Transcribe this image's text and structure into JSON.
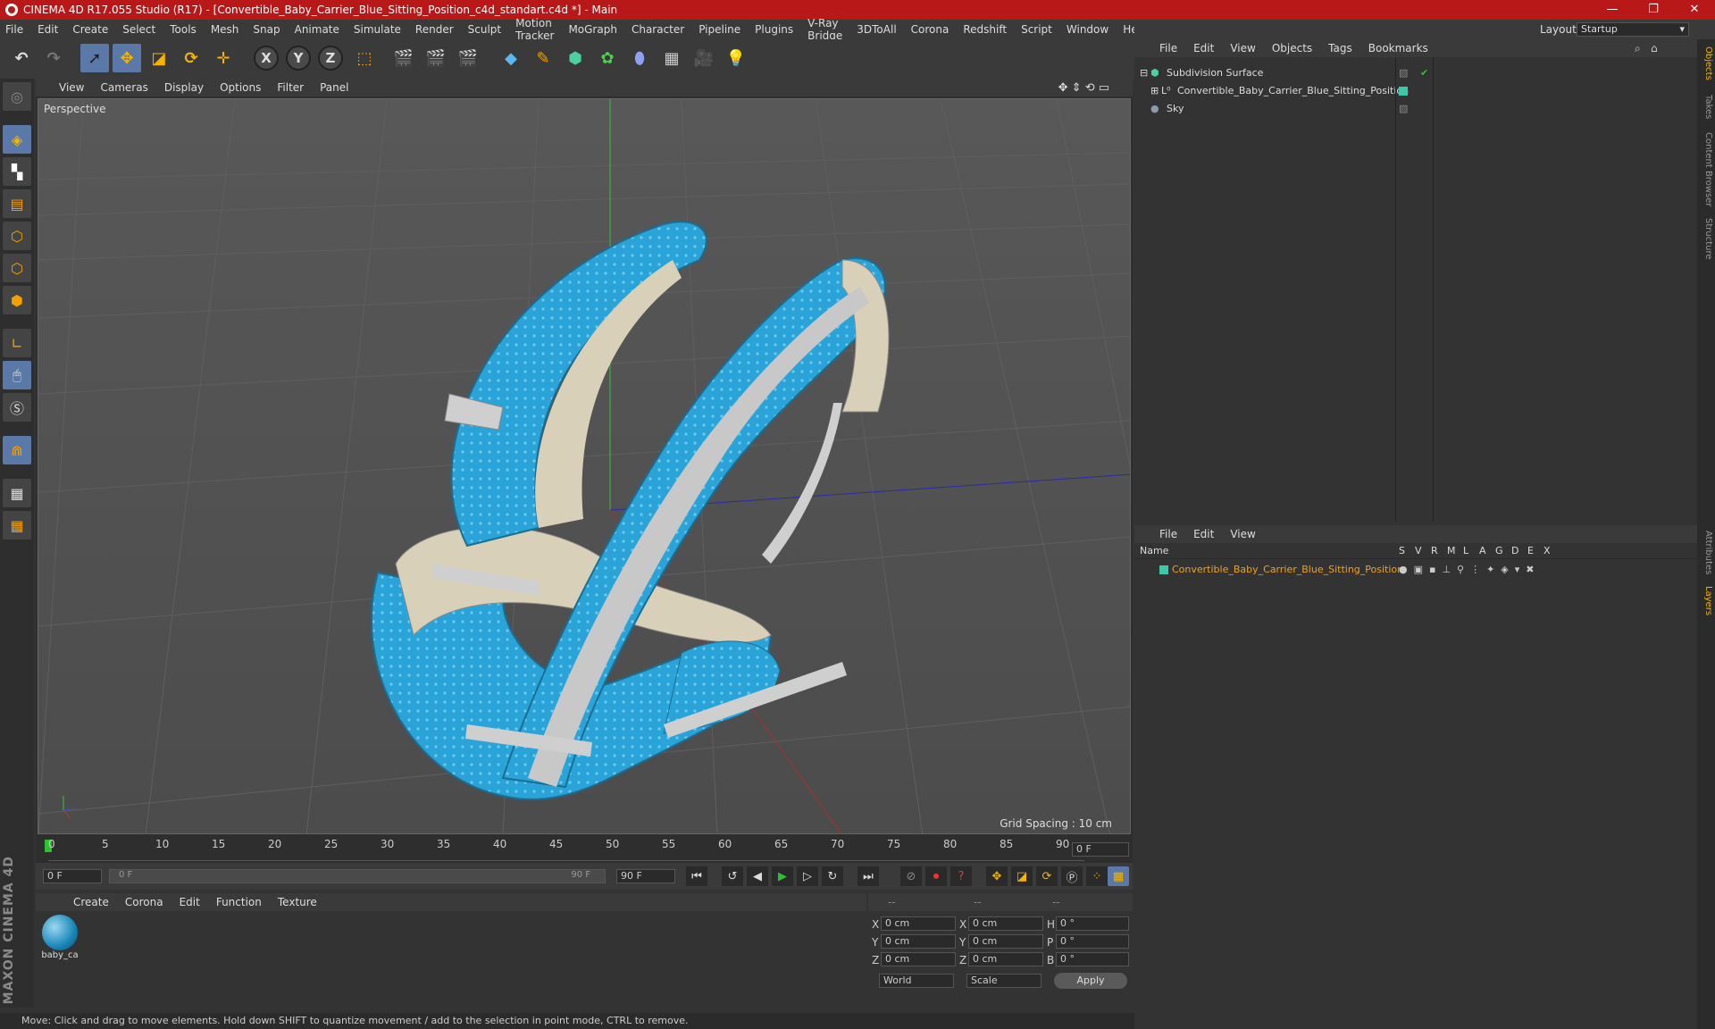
{
  "window": {
    "title": "CINEMA 4D R17.055 Studio (R17) - [Convertible_Baby_Carrier_Blue_Sitting_Position_c4d_standart.c4d *] - Main",
    "minimize": "—",
    "maximize": "❐",
    "close": "✕"
  },
  "menu": [
    "File",
    "Edit",
    "Create",
    "Select",
    "Tools",
    "Mesh",
    "Snap",
    "Animate",
    "Simulate",
    "Render",
    "Sculpt",
    "Motion Tracker",
    "MoGraph",
    "Character",
    "Pipeline",
    "Plugins",
    "V-Ray Bridge",
    "3DToAll",
    "Corona",
    "Redshift",
    "Script",
    "Window",
    "Help"
  ],
  "layout": {
    "label": "Layout:",
    "value": "Startup"
  },
  "viewport": {
    "menu": [
      "View",
      "Cameras",
      "Display",
      "Options",
      "Filter",
      "Panel"
    ],
    "name": "Perspective",
    "grid_spacing": "Grid Spacing : 10 cm"
  },
  "timeline": {
    "ticks": [
      "0",
      "5",
      "10",
      "15",
      "20",
      "25",
      "30",
      "35",
      "40",
      "45",
      "50",
      "55",
      "60",
      "65",
      "70",
      "75",
      "80",
      "85",
      "90"
    ],
    "current_frame": "0 F",
    "start": "0 F",
    "range_start": "0 F",
    "range_end": "90 F",
    "end": "90 F"
  },
  "material_manager": {
    "menu": [
      "Create",
      "Corona",
      "Edit",
      "Function",
      "Texture"
    ],
    "materials": [
      {
        "name": "baby_ca"
      }
    ]
  },
  "coordinates": {
    "header": [
      "--",
      "--",
      "--"
    ],
    "rows": [
      {
        "a": "X",
        "av": "0 cm",
        "b": "X",
        "bv": "0 cm",
        "c": "H",
        "cv": "0 °"
      },
      {
        "a": "Y",
        "av": "0 cm",
        "b": "Y",
        "bv": "0 cm",
        "c": "P",
        "cv": "0 °"
      },
      {
        "a": "Z",
        "av": "0 cm",
        "b": "Z",
        "bv": "0 cm",
        "c": "B",
        "cv": "0 °"
      }
    ],
    "mode": "World",
    "scale": "Scale",
    "apply": "Apply"
  },
  "status": "Move: Click and drag to move elements. Hold down SHIFT to quantize movement / add to the selection in point mode, CTRL to remove.",
  "object_manager": {
    "menu": [
      "File",
      "Edit",
      "View",
      "Objects",
      "Tags",
      "Bookmarks"
    ],
    "objects": [
      {
        "name": "Subdivision Surface",
        "color": "#3fc8a8"
      },
      {
        "name": "Convertible_Baby_Carrier_Blue_Sitting_Position",
        "color": "#3fc8a8"
      },
      {
        "name": "Sky",
        "color": "#8a9bb0"
      }
    ]
  },
  "layer_manager": {
    "menu": [
      "File",
      "Edit",
      "View"
    ],
    "columns": [
      "Name",
      "S",
      "V",
      "R",
      "M",
      "L",
      "A",
      "G",
      "D",
      "E",
      "X"
    ],
    "layers": [
      {
        "name": "Convertible_Baby_Carrier_Blue_Sitting_Position",
        "color": "#3fc8a8"
      }
    ]
  },
  "side_tabs": [
    "Objects",
    "Takes",
    "Content Browser",
    "Structure",
    "Attributes",
    "Layers"
  ],
  "brand": "MAXON CINEMA 4D"
}
